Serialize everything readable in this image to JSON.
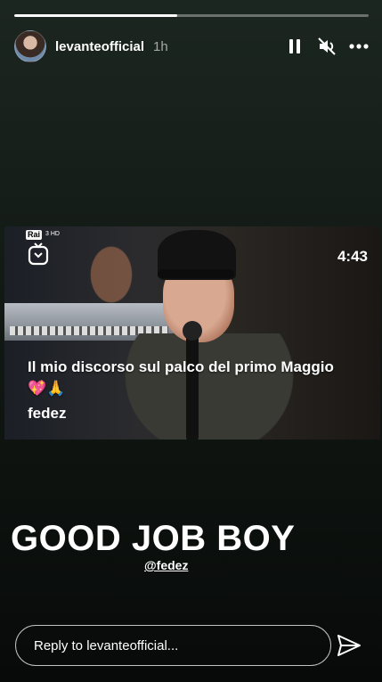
{
  "story": {
    "progress": 0.46,
    "username": "levanteofficial",
    "time": "1h",
    "avatar_icon": "profile-avatar",
    "controls": [
      "pause-icon",
      "mute-icon",
      "more-icon"
    ]
  },
  "video": {
    "broadcaster": "Rai",
    "broadcaster_sub": "3 HD",
    "duration": "4:43",
    "caption": "Il mio discorso sul palco del primo Maggio 💖🙏",
    "channel": "fedez",
    "igtv_icon": "igtv-icon"
  },
  "overlay": {
    "headline": "GOOD JOB BOY",
    "mention": "@fedez"
  },
  "reply": {
    "placeholder": "Reply to levanteofficial...",
    "send_icon": "send-icon"
  }
}
